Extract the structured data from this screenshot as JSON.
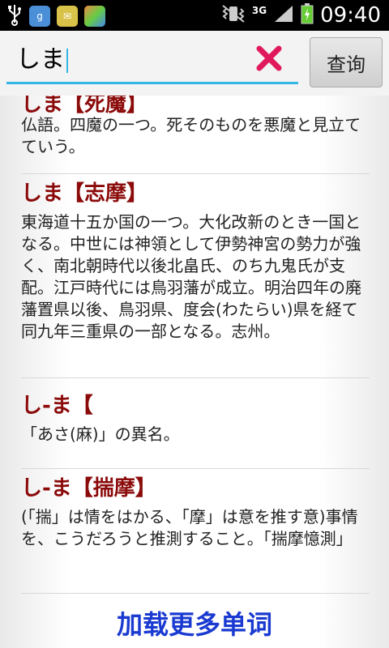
{
  "status_bar": {
    "time": "09:40",
    "network": "3G",
    "icons": [
      "usb-icon",
      "app-icon",
      "mail-icon",
      "photo-icon",
      "vibrate-icon",
      "signal-icon",
      "battery-icon"
    ]
  },
  "search": {
    "query": "しま",
    "button_label": "查询"
  },
  "results": [
    {
      "title": "しま【死魔】",
      "body": "仏語。四魔の一つ。死そのものを悪魔と見立てていう。"
    },
    {
      "title": "しま【志摩】",
      "body": "東海道十五か国の一つ。大化改新のとき一国となる。中世には神領として伊勢神宮の勢力が強く、南北朝時代以後北畠氏、のち九鬼氏が支配。江戸時代には鳥羽藩が成立。明治四年の廃藩置県以後、鳥羽県、度会(わたらい)県を経て同九年三重県の一部となる。志州。"
    },
    {
      "title": "し-ま【",
      "body": "「あさ(麻)」の異名。"
    },
    {
      "title": "し-ま【揣摩】",
      "body": "(「揣」は情をはかる、「摩」は意を推す意)事情を、こうだろうと推測すること。「揣摩憶測」"
    }
  ],
  "load_more_label": "加载更多单词",
  "colors": {
    "accent": "#33b5e5",
    "title": "#8b0a0a",
    "link": "#1a3ad1",
    "clear": "#e0195c"
  }
}
